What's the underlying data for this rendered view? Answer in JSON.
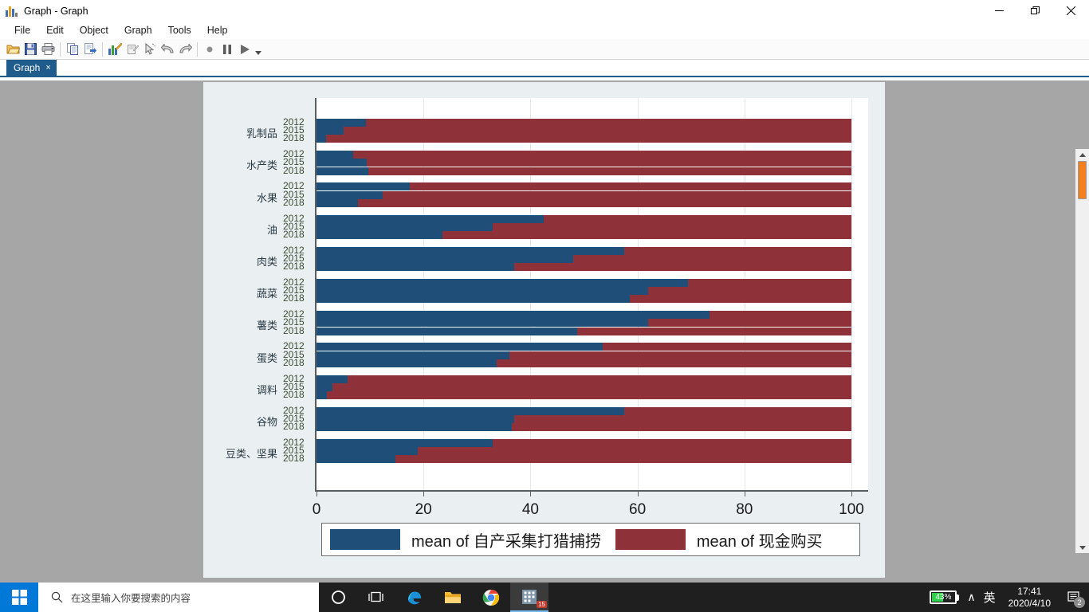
{
  "window": {
    "title": "Graph - Graph",
    "app_icon": "bar-chart-icon",
    "controls": {
      "minimize": "minimize-icon",
      "restore": "restore-icon",
      "close": "close-icon"
    }
  },
  "menubar": {
    "items": [
      "File",
      "Edit",
      "Object",
      "Graph",
      "Tools",
      "Help"
    ]
  },
  "toolbar": {
    "buttons": [
      "open-icon",
      "save-icon",
      "print-icon",
      "copy-icon",
      "copy-to-icon",
      "graph-editor-icon",
      "edit-object-icon",
      "pointer-icon",
      "undo-icon",
      "redo-icon",
      "record-icon",
      "pause-icon",
      "play-icon",
      "overflow-caret-icon"
    ]
  },
  "tabs": [
    {
      "label": "Graph",
      "close": "×",
      "active": true
    }
  ],
  "scrollbar": {
    "up": "▲",
    "down": "▼",
    "thumb_color": "#f08020"
  },
  "chart_data": {
    "type": "bar",
    "orientation": "horizontal",
    "stacked": true,
    "stack_total": 100,
    "title": "",
    "xlabel": "",
    "ylabel": "",
    "xlim": [
      0,
      100
    ],
    "xticks": [
      0,
      20,
      40,
      60,
      80,
      100
    ],
    "grid": "vertical",
    "legend_position": "bottom",
    "series": [
      {
        "name": "mean of 自产采集打猎捕捞",
        "color": "#1f4e79"
      },
      {
        "name": "mean of 现金购买",
        "color": "#8f3139"
      }
    ],
    "year_labels": [
      "2012",
      "2015",
      "2018"
    ],
    "groups": [
      {
        "category": "乳制品",
        "rows": [
          {
            "year": "2012",
            "values": [
              9.3,
              90.7
            ]
          },
          {
            "year": "2015",
            "values": [
              5.1,
              94.9
            ]
          },
          {
            "year": "2018",
            "values": [
              1.8,
              98.2
            ]
          }
        ]
      },
      {
        "category": "水产类",
        "rows": [
          {
            "year": "2012",
            "values": [
              6.9,
              93.1
            ]
          },
          {
            "year": "2015",
            "values": [
              9.4,
              90.6
            ]
          },
          {
            "year": "2018",
            "values": [
              9.7,
              90.3
            ]
          }
        ]
      },
      {
        "category": "水果",
        "rows": [
          {
            "year": "2012",
            "values": [
              17.5,
              82.5
            ]
          },
          {
            "year": "2015",
            "values": [
              12.3,
              87.7
            ]
          },
          {
            "year": "2018",
            "values": [
              7.8,
              92.2
            ]
          }
        ]
      },
      {
        "category": "油",
        "rows": [
          {
            "year": "2012",
            "values": [
              42.5,
              57.5
            ]
          },
          {
            "year": "2015",
            "values": [
              33.0,
              67.0
            ]
          },
          {
            "year": "2018",
            "values": [
              23.6,
              76.4
            ]
          }
        ]
      },
      {
        "category": "肉类",
        "rows": [
          {
            "year": "2012",
            "values": [
              57.5,
              42.5
            ]
          },
          {
            "year": "2015",
            "values": [
              48.0,
              52.0
            ]
          },
          {
            "year": "2018",
            "values": [
              37.0,
              63.0
            ]
          }
        ]
      },
      {
        "category": "蔬菜",
        "rows": [
          {
            "year": "2012",
            "values": [
              69.5,
              30.5
            ]
          },
          {
            "year": "2015",
            "values": [
              62.0,
              38.0
            ]
          },
          {
            "year": "2018",
            "values": [
              58.5,
              41.5
            ]
          }
        ]
      },
      {
        "category": "薯类",
        "rows": [
          {
            "year": "2012",
            "values": [
              73.5,
              26.5
            ]
          },
          {
            "year": "2015",
            "values": [
              62.0,
              38.0
            ]
          },
          {
            "year": "2018",
            "values": [
              48.8,
              51.2
            ]
          }
        ]
      },
      {
        "category": "蛋类",
        "rows": [
          {
            "year": "2012",
            "values": [
              53.5,
              46.5
            ]
          },
          {
            "year": "2015",
            "values": [
              36.0,
              64.0
            ]
          },
          {
            "year": "2018",
            "values": [
              33.7,
              66.3
            ]
          }
        ]
      },
      {
        "category": "调料",
        "rows": [
          {
            "year": "2012",
            "values": [
              5.8,
              94.2
            ]
          },
          {
            "year": "2015",
            "values": [
              3.0,
              97.0
            ]
          },
          {
            "year": "2018",
            "values": [
              2.0,
              98.0
            ]
          }
        ]
      },
      {
        "category": "谷物",
        "rows": [
          {
            "year": "2012",
            "values": [
              57.5,
              42.5
            ]
          },
          {
            "year": "2015",
            "values": [
              37.0,
              63.0
            ]
          },
          {
            "year": "2018",
            "values": [
              36.5,
              63.5
            ]
          }
        ]
      },
      {
        "category": "豆类、坚果",
        "rows": [
          {
            "year": "2012",
            "values": [
              33.0,
              67.0
            ]
          },
          {
            "year": "2015",
            "values": [
              19.0,
              81.0
            ]
          },
          {
            "year": "2018",
            "values": [
              14.7,
              85.3
            ]
          }
        ]
      }
    ]
  },
  "taskbar": {
    "start": "windows-logo-icon",
    "search": {
      "placeholder": "在这里输入你要搜索的内容",
      "icon": "search-icon"
    },
    "tasks": [
      "cortana-icon",
      "task-view-icon",
      "edge-icon",
      "file-explorer-icon",
      "chrome-icon",
      "stata-icon"
    ],
    "stata_badge": "15",
    "tray": {
      "battery_percent": "43%",
      "battery_level": 43,
      "chevron": "∧",
      "ime": "英",
      "time": "17:41",
      "date": "2020/4/10",
      "notification_count": "2"
    }
  }
}
